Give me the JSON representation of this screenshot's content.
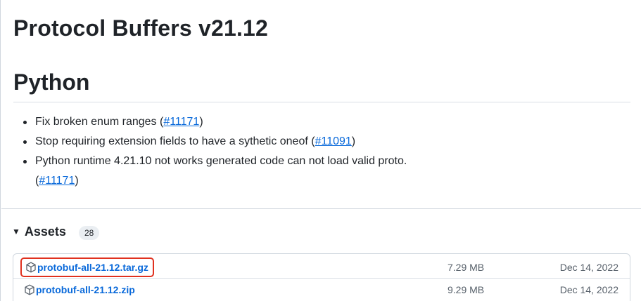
{
  "release": {
    "title": "Protocol Buffers v21.12",
    "section": "Python"
  },
  "notes": [
    {
      "text": "Fix broken enum ranges (",
      "link": "#11171",
      "after": ")"
    },
    {
      "text": "Stop requiring extension fields to have a sythetic oneof (",
      "link": "#11091",
      "after": ")"
    },
    {
      "text": "Python runtime 4.21.10 not works generated code can not load valid proto.",
      "cont_before": "(",
      "link": "#11171",
      "after": ")"
    }
  ],
  "assets": {
    "label": "Assets",
    "count": "28",
    "caret_icon": "triangle-down-icon",
    "items": [
      {
        "name": "protobuf-all-21.12.tar.gz",
        "size": "7.29 MB",
        "date": "Dec 14, 2022",
        "icon": "package-icon"
      },
      {
        "name": "protobuf-all-21.12.zip",
        "size": "9.29 MB",
        "date": "Dec 14, 2022",
        "icon": "package-icon"
      }
    ]
  },
  "colors": {
    "link": "#0969da",
    "highlight_border": "#e0311f",
    "muted_text": "#57606a"
  }
}
